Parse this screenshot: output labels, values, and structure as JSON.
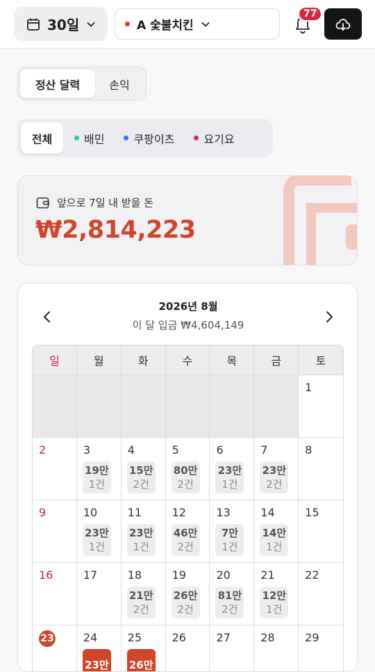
{
  "topbar": {
    "period_label": "30일",
    "store_label": "A 숯불치킨",
    "notification_count": "77"
  },
  "view_tabs": [
    {
      "label": "정산 달력",
      "active": true
    },
    {
      "label": "손익",
      "active": false
    }
  ],
  "channel_tabs": [
    {
      "label": "전체",
      "active": true,
      "dot": null
    },
    {
      "label": "배민",
      "active": false,
      "dot": "#2ec4b6"
    },
    {
      "label": "쿠팡이츠",
      "active": false,
      "dot": "#2f7cf6"
    },
    {
      "label": "요기요",
      "active": false,
      "dot": "#e0245e"
    }
  ],
  "incoming": {
    "label": "앞으로 7일 내 받을 돈",
    "amount": "₩2,814,223"
  },
  "calendar": {
    "title": "2026년 8월",
    "subtitle": "이 달 입금 ₩4,604,149",
    "weekdays": [
      "일",
      "월",
      "화",
      "수",
      "목",
      "금",
      "토"
    ],
    "weeks": [
      [
        {
          "day": ""
        },
        {
          "day": ""
        },
        {
          "day": ""
        },
        {
          "day": ""
        },
        {
          "day": ""
        },
        {
          "day": ""
        },
        {
          "day": "1"
        }
      ],
      [
        {
          "day": "2"
        },
        {
          "day": "3",
          "amount": "19만",
          "count": "1건"
        },
        {
          "day": "4",
          "amount": "15만",
          "count": "2건"
        },
        {
          "day": "5",
          "amount": "80만",
          "count": "2건"
        },
        {
          "day": "6",
          "amount": "23만",
          "count": "1건"
        },
        {
          "day": "7",
          "amount": "23만",
          "count": "2건"
        },
        {
          "day": "8"
        }
      ],
      [
        {
          "day": "9"
        },
        {
          "day": "10",
          "amount": "23만",
          "count": "1건"
        },
        {
          "day": "11",
          "amount": "23만",
          "count": "1건"
        },
        {
          "day": "12",
          "amount": "46만",
          "count": "2건"
        },
        {
          "day": "13",
          "amount": "7만",
          "count": "1건"
        },
        {
          "day": "14",
          "amount": "14만",
          "count": "1건"
        },
        {
          "day": "15"
        }
      ],
      [
        {
          "day": "16"
        },
        {
          "day": "17"
        },
        {
          "day": "18",
          "amount": "21만",
          "count": "2건"
        },
        {
          "day": "19",
          "amount": "26만",
          "count": "2건"
        },
        {
          "day": "20",
          "amount": "81만",
          "count": "2건"
        },
        {
          "day": "21",
          "amount": "12만",
          "count": "1건"
        },
        {
          "day": "22"
        }
      ],
      [
        {
          "day": "23",
          "today": true
        },
        {
          "day": "24",
          "amount": "23만",
          "count": "",
          "highlight": true
        },
        {
          "day": "25",
          "amount": "26만",
          "count": "",
          "highlight": true
        },
        {
          "day": "26"
        },
        {
          "day": "27"
        },
        {
          "day": "28"
        },
        {
          "day": "29"
        }
      ]
    ]
  },
  "colors": {
    "accent": "#d2452b",
    "sunday": "#d0213c",
    "badge": "#e0243a"
  }
}
